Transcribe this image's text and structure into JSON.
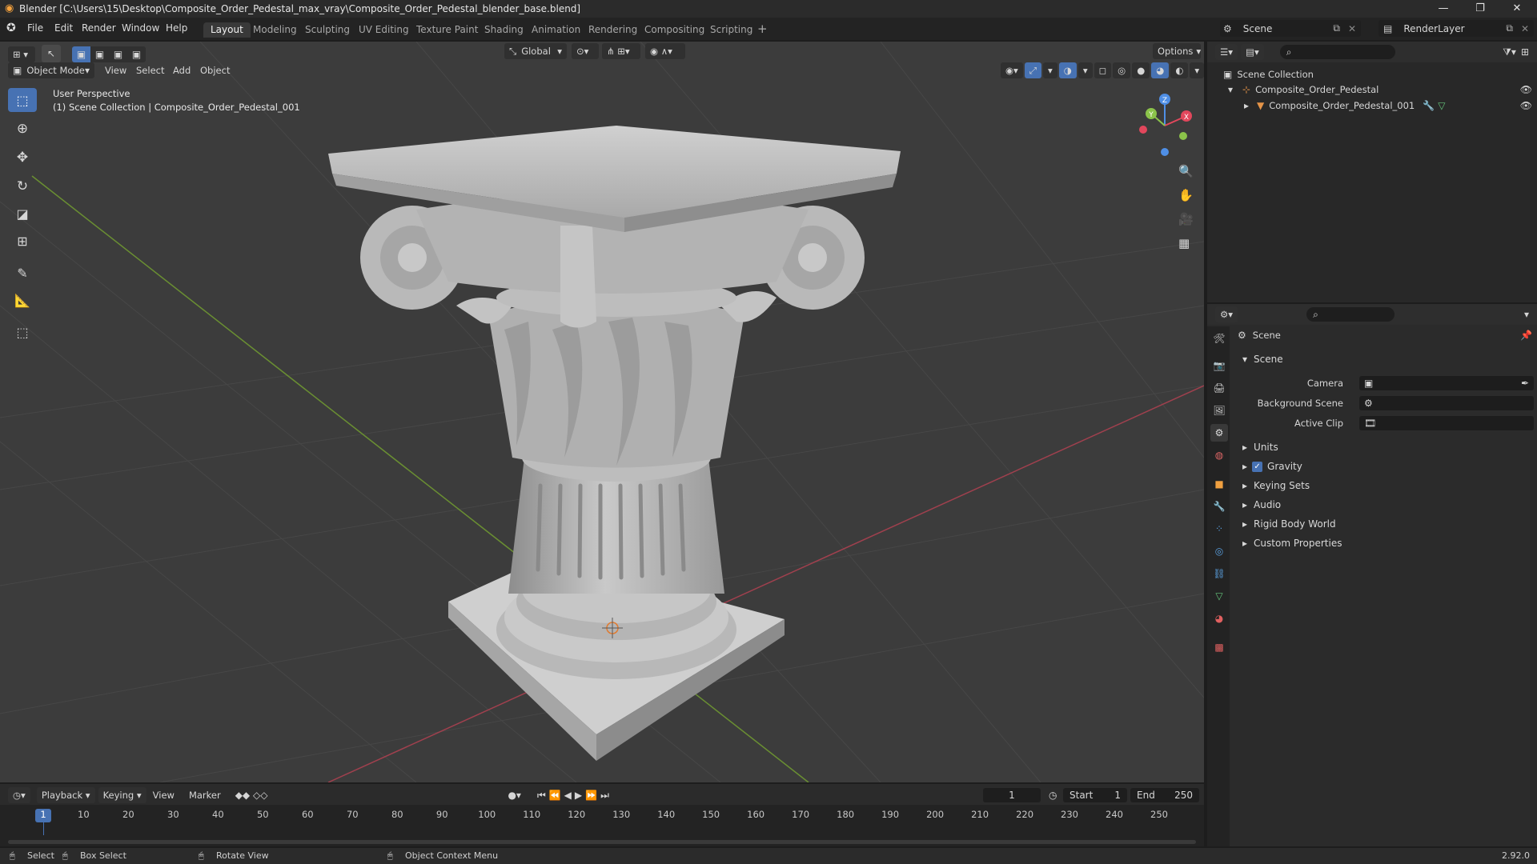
{
  "window": {
    "title": "Blender [C:\\Users\\15\\Desktop\\Composite_Order_Pedestal_max_vray\\Composite_Order_Pedestal_blender_base.blend]"
  },
  "menu": [
    "File",
    "Edit",
    "Render",
    "Window",
    "Help"
  ],
  "workspaces": [
    "Layout",
    "Modeling",
    "Sculpting",
    "UV Editing",
    "Texture Paint",
    "Shading",
    "Animation",
    "Rendering",
    "Compositing",
    "Scripting"
  ],
  "scene_selector": {
    "value": "Scene"
  },
  "renderlayer_selector": {
    "value": "RenderLayer"
  },
  "viewport": {
    "mode": "Object Mode",
    "menus": [
      "View",
      "Select",
      "Add",
      "Object"
    ],
    "transform_orientation": "Global",
    "options_label": "Options",
    "overlay_line1": "User Perspective",
    "overlay_line2": "(1) Scene Collection | Composite_Order_Pedestal_001",
    "gizmo": {
      "x": "X",
      "y": "Y",
      "z": "Z"
    }
  },
  "outliner": {
    "root": "Scene Collection",
    "items": [
      {
        "name": "Composite_Order_Pedestal"
      },
      {
        "name": "Composite_Order_Pedestal_001"
      }
    ]
  },
  "properties": {
    "context_title": "Scene",
    "panel_title": "Scene",
    "fields": [
      {
        "label": "Camera",
        "value": ""
      },
      {
        "label": "Background Scene",
        "value": ""
      },
      {
        "label": "Active Clip",
        "value": ""
      }
    ],
    "sections": [
      "Units",
      "Gravity",
      "Keying Sets",
      "Audio",
      "Rigid Body World",
      "Custom Properties"
    ],
    "gravity_checked": true
  },
  "timeline": {
    "menus": [
      "Playback",
      "Keying",
      "View",
      "Marker"
    ],
    "current_frame": "1",
    "start_label": "Start",
    "start_value": "1",
    "end_label": "End",
    "end_value": "250",
    "ticks": [
      "1",
      "10",
      "20",
      "30",
      "40",
      "50",
      "60",
      "70",
      "80",
      "90",
      "100",
      "110",
      "120",
      "130",
      "140",
      "150",
      "160",
      "170",
      "180",
      "190",
      "200",
      "210",
      "220",
      "230",
      "240",
      "250"
    ]
  },
  "statusbar": {
    "select": "Select",
    "box_select": "Box Select",
    "rotate_view": "Rotate View",
    "context_menu": "Object Context Menu",
    "version": "2.92.0"
  },
  "colors": {
    "accent": "#4772b3",
    "x_axis": "#e2475c",
    "y_axis": "#8bc34a",
    "z_axis": "#4f8fe6",
    "active_tab": "#393939"
  }
}
